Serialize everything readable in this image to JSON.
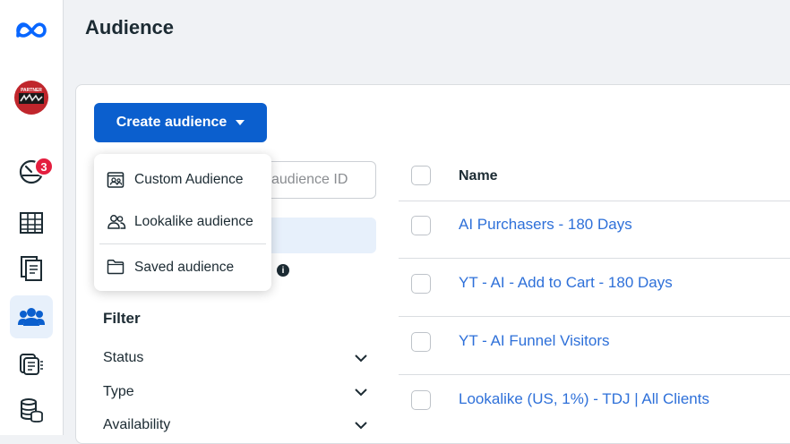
{
  "header": {
    "title": "Audience"
  },
  "rail": {
    "items": [
      {
        "icon": "meta-logo-icon"
      },
      {
        "icon": "partner-avatar",
        "avatar_text": "PARTNER"
      },
      {
        "icon": "dashboard-icon",
        "badge": "3"
      },
      {
        "icon": "table-icon"
      },
      {
        "icon": "pages-icon"
      },
      {
        "icon": "audience-people-icon",
        "active": true
      },
      {
        "icon": "catalog-icon"
      },
      {
        "icon": "database-icon"
      }
    ],
    "accent": "#0b5fce"
  },
  "toolbar": {
    "create_label": "Create audience"
  },
  "search": {
    "placeholder": "audience ID"
  },
  "info_icon": "i",
  "menu": {
    "items": [
      {
        "label": "Custom Audience",
        "icon": "custom-audience-icon"
      },
      {
        "label": "Lookalike audience",
        "icon": "lookalike-people-icon"
      },
      {
        "label": "Saved audience",
        "icon": "folder-icon"
      }
    ]
  },
  "filter": {
    "heading": "Filter",
    "rows": [
      {
        "label": "Status"
      },
      {
        "label": "Type"
      },
      {
        "label": "Availability"
      }
    ]
  },
  "table": {
    "columns": [
      "Name"
    ],
    "rows": [
      {
        "name": "AI Purchasers - 180 Days"
      },
      {
        "name": "YT - AI - Add to Cart - 180 Days"
      },
      {
        "name": "YT - AI Funnel Visitors"
      },
      {
        "name": "Lookalike (US, 1%) - TDJ | All Clients"
      }
    ]
  },
  "colors": {
    "link": "#2e70d9",
    "primary_button": "#0b5fce",
    "badge": "#e41e3f"
  }
}
